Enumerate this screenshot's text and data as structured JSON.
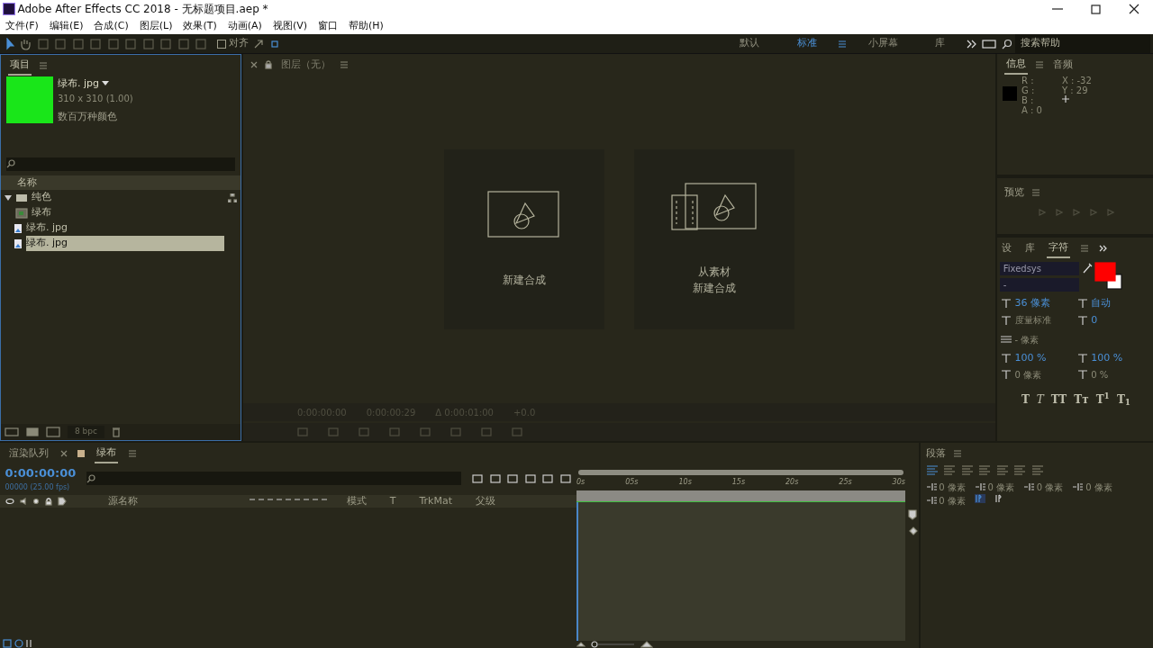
{
  "window": {
    "title": "Adobe After Effects CC 2018 - 无标题项目.aep *"
  },
  "menu": [
    "文件(F)",
    "编辑(E)",
    "合成(C)",
    "图层(L)",
    "效果(T)",
    "动画(A)",
    "视图(V)",
    "窗口",
    "帮助(H)"
  ],
  "toolbar": {
    "snap": {
      "label": "对齐",
      "checked": false
    },
    "workspaces": [
      {
        "label": "默认",
        "selected": false
      },
      {
        "label": "标准",
        "selected": true
      },
      {
        "label": "小屏幕",
        "selected": false
      },
      {
        "label": "库",
        "selected": false
      }
    ],
    "search": {
      "placeholder": "搜索帮助"
    }
  },
  "project": {
    "tab": "项目",
    "preview": {
      "name": "绿布. jpg",
      "dims": "310 x 310 (1.00)",
      "colors": "数百万种颜色"
    },
    "column": "名称",
    "items": [
      {
        "label": "纯色",
        "kind": "folder",
        "expanded": true,
        "selected": false,
        "children": [
          {
            "label": "绿布",
            "kind": "solid",
            "selected": false
          }
        ]
      },
      {
        "label": "绿布. jpg",
        "kind": "image",
        "selected": false
      },
      {
        "label": "绿布. jpg",
        "kind": "image",
        "selected": true
      }
    ],
    "bpc": "8 bpc"
  },
  "viewer": {
    "tab": "图层（无）",
    "actions": [
      {
        "lines": [
          "新建合成"
        ],
        "kind": "new"
      },
      {
        "lines": [
          "从素材",
          "新建合成"
        ],
        "kind": "footage"
      }
    ],
    "footer": [
      "0:00:00:00",
      "0:00:00:29",
      "Δ 0:00:01:00",
      "+0.0"
    ]
  },
  "info": {
    "tabs": [
      {
        "label": "信息",
        "selected": true
      },
      {
        "label": "音频",
        "selected": false
      }
    ],
    "channels": [
      "R :",
      "G :",
      "B :",
      "A : 0"
    ],
    "coords": [
      "X : -32",
      "Y : 29"
    ]
  },
  "preview": {
    "title": "预览"
  },
  "character": {
    "tabs": [
      {
        "label": "设",
        "selected": false
      },
      {
        "label": "库",
        "selected": false
      },
      {
        "label": "字符",
        "selected": true
      }
    ],
    "font": "Fixedsys",
    "style": "-",
    "fields": [
      {
        "value": "36 像素",
        "accent": true
      },
      {
        "value": "自动",
        "accent": true
      },
      {
        "value": "度量标准",
        "accent": false
      },
      {
        "value": "0",
        "accent": true
      }
    ],
    "stroke": "- 像素",
    "scales": [
      {
        "value": "100 %"
      },
      {
        "value": "100 %"
      },
      {
        "value": "0 像素"
      },
      {
        "value": "0 %"
      }
    ],
    "styles": [
      {
        "label": "T",
        "kind": "bold"
      },
      {
        "label": "T",
        "kind": "italic"
      },
      {
        "label": "TT",
        "kind": "caps"
      },
      {
        "label": "Tт",
        "kind": "smallcaps"
      },
      {
        "label": "T$^{1}$",
        "kind": "super"
      },
      {
        "label": "T$_{1}$",
        "kind": "sub"
      }
    ]
  },
  "timeline": {
    "tabs": [
      {
        "label": "渲染队列",
        "selected": false
      },
      {
        "label": "绿布",
        "selected": true
      }
    ],
    "timecode": "0:00:00:00",
    "fps": "00000 (25.00 fps)",
    "columns": [
      "源名称",
      "模式",
      "T",
      "TrkMat",
      "父级"
    ],
    "ruler": [
      "0s",
      "05s",
      "10s",
      "15s",
      "20s",
      "25s",
      "30s"
    ]
  },
  "paragraph": {
    "title": "段落",
    "align": [
      {
        "selected": true
      },
      {
        "selected": false
      },
      {
        "selected": false
      },
      {
        "selected": false
      },
      {
        "selected": false
      },
      {
        "selected": false
      },
      {
        "selected": false
      }
    ],
    "indents": [
      "0 像素",
      "0 像素",
      "0 像素",
      "0 像素",
      "0 像素"
    ],
    "direction": [
      {
        "selected": true
      },
      {
        "selected": false
      }
    ]
  }
}
